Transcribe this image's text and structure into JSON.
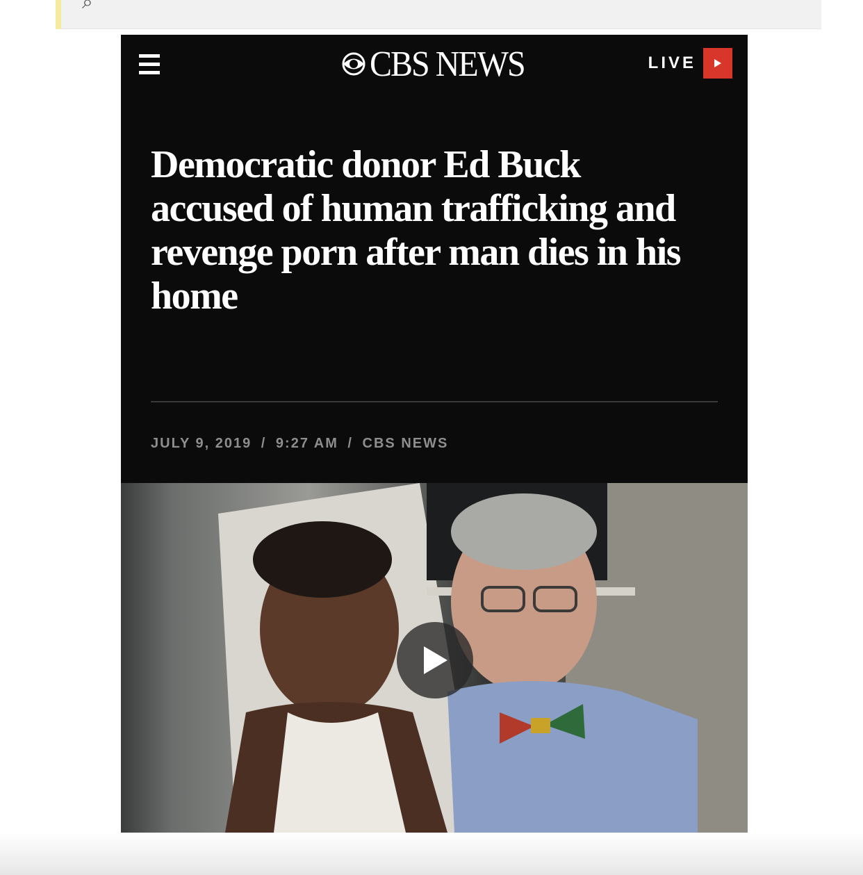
{
  "browser": {
    "search_glyph": "⌕"
  },
  "site": {
    "logo_text": "CBS NEWS",
    "live_label": "LIVE"
  },
  "article": {
    "headline": "Democratic donor Ed Buck accused of human trafficking and revenge porn after man dies in his home",
    "date": "JULY 9, 2019",
    "time": "9:27 AM",
    "source": "CBS NEWS",
    "separator": "/"
  },
  "colors": {
    "page_bg": "#0b0b0b",
    "live_accent": "#d8352b",
    "meta_text": "#8e8e8e"
  },
  "icons": {
    "menu": "hamburger-icon",
    "logo_mark": "cbs-eye-icon",
    "live_play": "play-icon",
    "video_play": "play-icon"
  }
}
